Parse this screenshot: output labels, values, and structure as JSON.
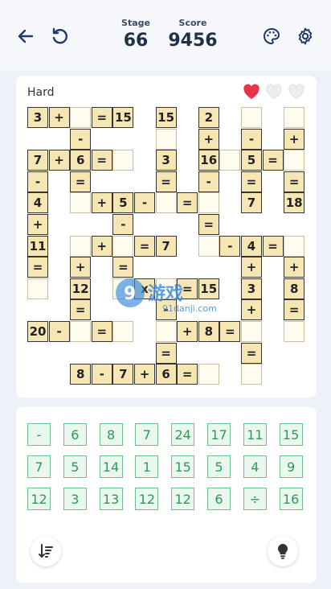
{
  "header": {
    "stage_label": "Stage",
    "stage_value": "66",
    "score_label": "Score",
    "score_value": "9456"
  },
  "board": {
    "difficulty": "Hard",
    "lives_total": 3,
    "lives_remaining": 1,
    "colors": {
      "heart_full": "#e8334a",
      "heart_empty": "#eeeeee"
    },
    "cells": [
      {
        "r": 0,
        "c": 0,
        "t": "3",
        "k": "g"
      },
      {
        "r": 0,
        "c": 1,
        "t": "+",
        "k": "g"
      },
      {
        "r": 0,
        "c": 2,
        "t": "",
        "k": "b"
      },
      {
        "r": 0,
        "c": 3,
        "t": "=",
        "k": "g"
      },
      {
        "r": 0,
        "c": 4,
        "t": "15",
        "k": "g"
      },
      {
        "r": 0,
        "c": 6,
        "t": "15",
        "k": "g"
      },
      {
        "r": 0,
        "c": 8,
        "t": "2",
        "k": "g"
      },
      {
        "r": 0,
        "c": 10,
        "t": "",
        "k": "b"
      },
      {
        "r": 0,
        "c": 12,
        "t": "",
        "k": "b"
      },
      {
        "r": 1,
        "c": 2,
        "t": "-",
        "k": "g"
      },
      {
        "r": 1,
        "c": 6,
        "t": "",
        "k": "b"
      },
      {
        "r": 1,
        "c": 8,
        "t": "+",
        "k": "g"
      },
      {
        "r": 1,
        "c": 10,
        "t": "-",
        "k": "g"
      },
      {
        "r": 1,
        "c": 12,
        "t": "+",
        "k": "g"
      },
      {
        "r": 2,
        "c": 0,
        "t": "7",
        "k": "g"
      },
      {
        "r": 2,
        "c": 1,
        "t": "+",
        "k": "g"
      },
      {
        "r": 2,
        "c": 2,
        "t": "6",
        "k": "g"
      },
      {
        "r": 2,
        "c": 3,
        "t": "=",
        "k": "g"
      },
      {
        "r": 2,
        "c": 4,
        "t": "",
        "k": "b"
      },
      {
        "r": 2,
        "c": 6,
        "t": "3",
        "k": "g"
      },
      {
        "r": 2,
        "c": 8,
        "t": "16",
        "k": "g"
      },
      {
        "r": 2,
        "c": 9,
        "t": "",
        "k": "b"
      },
      {
        "r": 2,
        "c": 10,
        "t": "5",
        "k": "g"
      },
      {
        "r": 2,
        "c": 11,
        "t": "=",
        "k": "g"
      },
      {
        "r": 2,
        "c": 12,
        "t": "",
        "k": "b"
      },
      {
        "r": 3,
        "c": 0,
        "t": "-",
        "k": "g"
      },
      {
        "r": 3,
        "c": 2,
        "t": "=",
        "k": "g"
      },
      {
        "r": 3,
        "c": 6,
        "t": "=",
        "k": "g"
      },
      {
        "r": 3,
        "c": 8,
        "t": "-",
        "k": "g"
      },
      {
        "r": 3,
        "c": 10,
        "t": "=",
        "k": "g"
      },
      {
        "r": 3,
        "c": 12,
        "t": "=",
        "k": "g"
      },
      {
        "r": 4,
        "c": 0,
        "t": "4",
        "k": "g"
      },
      {
        "r": 4,
        "c": 2,
        "t": "",
        "k": "b"
      },
      {
        "r": 4,
        "c": 3,
        "t": "+",
        "k": "g"
      },
      {
        "r": 4,
        "c": 4,
        "t": "5",
        "k": "g"
      },
      {
        "r": 4,
        "c": 5,
        "t": "-",
        "k": "g"
      },
      {
        "r": 4,
        "c": 6,
        "t": "",
        "k": "b"
      },
      {
        "r": 4,
        "c": 7,
        "t": "=",
        "k": "g"
      },
      {
        "r": 4,
        "c": 8,
        "t": "",
        "k": "b"
      },
      {
        "r": 4,
        "c": 10,
        "t": "7",
        "k": "g"
      },
      {
        "r": 4,
        "c": 12,
        "t": "18",
        "k": "g"
      },
      {
        "r": 5,
        "c": 0,
        "t": "+",
        "k": "g"
      },
      {
        "r": 5,
        "c": 4,
        "t": "-",
        "k": "g"
      },
      {
        "r": 5,
        "c": 8,
        "t": "=",
        "k": "g"
      },
      {
        "r": 6,
        "c": 0,
        "t": "11",
        "k": "g"
      },
      {
        "r": 6,
        "c": 2,
        "t": "",
        "k": "b"
      },
      {
        "r": 6,
        "c": 3,
        "t": "+",
        "k": "g"
      },
      {
        "r": 6,
        "c": 4,
        "t": "",
        "k": "b"
      },
      {
        "r": 6,
        "c": 5,
        "t": "=",
        "k": "g"
      },
      {
        "r": 6,
        "c": 6,
        "t": "7",
        "k": "g"
      },
      {
        "r": 6,
        "c": 8,
        "t": "",
        "k": "b"
      },
      {
        "r": 6,
        "c": 9,
        "t": "-",
        "k": "g"
      },
      {
        "r": 6,
        "c": 10,
        "t": "4",
        "k": "g"
      },
      {
        "r": 6,
        "c": 11,
        "t": "=",
        "k": "g"
      },
      {
        "r": 6,
        "c": 12,
        "t": "",
        "k": "b"
      },
      {
        "r": 7,
        "c": 0,
        "t": "=",
        "k": "g"
      },
      {
        "r": 7,
        "c": 2,
        "t": "+",
        "k": "g"
      },
      {
        "r": 7,
        "c": 4,
        "t": "=",
        "k": "g"
      },
      {
        "r": 7,
        "c": 10,
        "t": "+",
        "k": "g"
      },
      {
        "r": 7,
        "c": 12,
        "t": "+",
        "k": "g"
      },
      {
        "r": 8,
        "c": 0,
        "t": "",
        "k": "b"
      },
      {
        "r": 8,
        "c": 2,
        "t": "12",
        "k": "g"
      },
      {
        "r": 8,
        "c": 4,
        "t": "",
        "k": "b"
      },
      {
        "r": 8,
        "c": 5,
        "t": "x",
        "k": "g"
      },
      {
        "r": 8,
        "c": 6,
        "t": "",
        "k": "b"
      },
      {
        "r": 8,
        "c": 7,
        "t": "=",
        "k": "g"
      },
      {
        "r": 8,
        "c": 8,
        "t": "15",
        "k": "g"
      },
      {
        "r": 8,
        "c": 10,
        "t": "3",
        "k": "g"
      },
      {
        "r": 8,
        "c": 12,
        "t": "8",
        "k": "g"
      },
      {
        "r": 9,
        "c": 2,
        "t": "=",
        "k": "g"
      },
      {
        "r": 9,
        "c": 6,
        "t": "-",
        "k": "g"
      },
      {
        "r": 9,
        "c": 10,
        "t": "+",
        "k": "g"
      },
      {
        "r": 9,
        "c": 12,
        "t": "=",
        "k": "g"
      },
      {
        "r": 10,
        "c": 0,
        "t": "20",
        "k": "g"
      },
      {
        "r": 10,
        "c": 1,
        "t": "-",
        "k": "g"
      },
      {
        "r": 10,
        "c": 2,
        "t": "",
        "k": "b"
      },
      {
        "r": 10,
        "c": 3,
        "t": "=",
        "k": "g"
      },
      {
        "r": 10,
        "c": 4,
        "t": "",
        "k": "b"
      },
      {
        "r": 10,
        "c": 6,
        "t": "",
        "k": "b"
      },
      {
        "r": 10,
        "c": 7,
        "t": "+",
        "k": "g"
      },
      {
        "r": 10,
        "c": 8,
        "t": "8",
        "k": "g"
      },
      {
        "r": 10,
        "c": 9,
        "t": "=",
        "k": "g"
      },
      {
        "r": 10,
        "c": 10,
        "t": "",
        "k": "b"
      },
      {
        "r": 10,
        "c": 12,
        "t": "",
        "k": "b"
      },
      {
        "r": 11,
        "c": 6,
        "t": "=",
        "k": "g"
      },
      {
        "r": 11,
        "c": 10,
        "t": "=",
        "k": "g"
      },
      {
        "r": 12,
        "c": 2,
        "t": "8",
        "k": "g"
      },
      {
        "r": 12,
        "c": 3,
        "t": "-",
        "k": "g"
      },
      {
        "r": 12,
        "c": 4,
        "t": "7",
        "k": "g"
      },
      {
        "r": 12,
        "c": 5,
        "t": "+",
        "k": "g"
      },
      {
        "r": 12,
        "c": 6,
        "t": "6",
        "k": "g"
      },
      {
        "r": 12,
        "c": 7,
        "t": "=",
        "k": "g"
      },
      {
        "r": 12,
        "c": 8,
        "t": "",
        "k": "b"
      },
      {
        "r": 12,
        "c": 10,
        "t": "",
        "k": "b"
      }
    ]
  },
  "tiles": [
    "-",
    "6",
    "8",
    "7",
    "24",
    "17",
    "11",
    "15",
    "7",
    "5",
    "14",
    "1",
    "15",
    "5",
    "4",
    "9",
    "12",
    "3",
    "13",
    "12",
    "12",
    "6",
    "÷",
    "16"
  ],
  "toolbar": {
    "sort_icon": "sort-icon",
    "hint_icon": "lightbulb-icon"
  },
  "watermark": {
    "logo": "9",
    "brand": "游戏",
    "domain": "91danji.com"
  }
}
